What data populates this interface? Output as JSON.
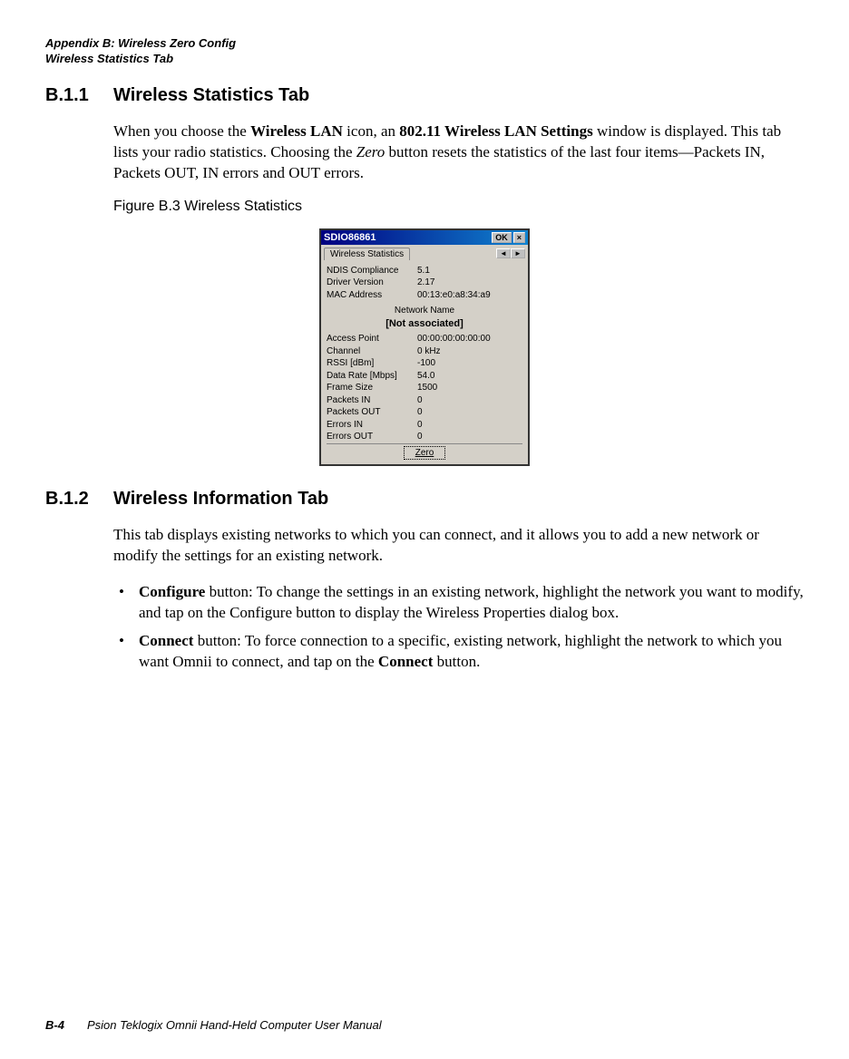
{
  "header": {
    "line1": "Appendix B: Wireless Zero Config",
    "line2": "Wireless Statistics Tab"
  },
  "section1": {
    "number": "B.1.1",
    "title": "Wireless Statistics Tab",
    "para_pre": "When you choose the ",
    "bold1": "Wireless LAN",
    "para_mid1": " icon, an ",
    "bold2": "802.11 Wireless LAN Settings",
    "para_mid2": " window is displayed. This tab lists your radio statistics. Choosing the ",
    "italic1": "Zero",
    "para_end": " button resets the statistics of the last four items—Packets IN, Packets OUT, IN errors and OUT errors.",
    "figure_caption": "Figure B.3  Wireless Statistics"
  },
  "screenshot": {
    "title": "SDIO86861",
    "ok": "OK",
    "close": "×",
    "tab": "Wireless Statistics",
    "scroll_left": "◄",
    "scroll_right": "►",
    "rows1": [
      {
        "label": "NDIS Compliance",
        "value": "5.1"
      },
      {
        "label": "Driver Version",
        "value": "2.17"
      },
      {
        "label": "MAC Address",
        "value": "00:13:e0:a8:34:a9"
      }
    ],
    "network_name_label": "Network Name",
    "not_associated": "[Not associated]",
    "rows2": [
      {
        "label": "Access Point",
        "value": "00:00:00:00:00:00"
      },
      {
        "label": "Channel",
        "value": "0 kHz"
      },
      {
        "label": "RSSI [dBm]",
        "value": "-100"
      },
      {
        "label": "Data Rate [Mbps]",
        "value": "54.0"
      },
      {
        "label": "Frame Size",
        "value": "1500"
      },
      {
        "label": "Packets IN",
        "value": "0"
      },
      {
        "label": "Packets OUT",
        "value": "0"
      },
      {
        "label": "Errors IN",
        "value": "0"
      },
      {
        "label": "Errors OUT",
        "value": "0"
      }
    ],
    "zero_button": "Zero"
  },
  "section2": {
    "number": "B.1.2",
    "title": "Wireless Information Tab",
    "para": "This tab displays existing networks to which you can connect, and it allows you to add a new network or modify the settings for an existing network.",
    "bullet1_bold": "Configure",
    "bullet1_text": " button: To change the settings in an existing network, highlight the network you want to modify, and tap on the Configure button to display the Wireless Properties dialog box.",
    "bullet2_bold": "Connect",
    "bullet2_text_pre": " button: To force connection to a specific, existing network, highlight the network to which you want Omnii to connect, and tap on the ",
    "bullet2_bold2": "Connect",
    "bullet2_text_post": " button."
  },
  "footer": {
    "page": "B-4",
    "text": "Psion Teklogix Omnii Hand-Held Computer User Manual"
  }
}
